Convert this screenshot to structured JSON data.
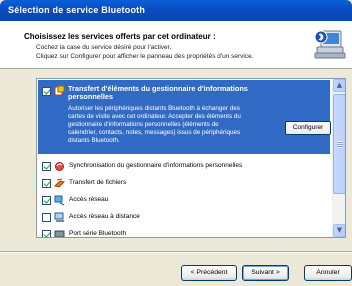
{
  "window": {
    "title": "Sélection de service Bluetooth"
  },
  "header": {
    "title": "Choisissez les services offerts par cet ordinateur :",
    "line1": "Cochez la case du service désiré pour l'activer.",
    "line2": "Cliquez sur Configurer pour afficher le panneau des propriétés d'un service."
  },
  "services": {
    "selected": {
      "title": "Transfert d'éléments du gestionnaire d'informations personnelles",
      "description": "Autoriser les périphériques distants Bluetooth à échanger des cartes de visite avec cet ordinateur. Accepter des éléments du gestionnaire d'informations personnelles (éléments de calendrier, contacts, notes, messages) issus de périphériques distants Bluetooth.",
      "configure_label": "Configurer",
      "checked": true,
      "icon": "pim-transfer-icon"
    },
    "items": [
      {
        "label": "Synchronisation du gestionnaire d'informations personnelles",
        "checked": true,
        "icon": "sync-icon"
      },
      {
        "label": "Transfert de fichiers",
        "checked": true,
        "icon": "file-transfer-icon"
      },
      {
        "label": "Accès réseau",
        "checked": true,
        "icon": "network-access-icon"
      },
      {
        "label": "Accès réseau à distance",
        "checked": false,
        "icon": "dialup-icon"
      },
      {
        "label": "Port série Bluetooth",
        "checked": true,
        "icon": "serial-port-icon"
      }
    ]
  },
  "buttons": {
    "prev": "< Précédent",
    "next": "Suivant >",
    "cancel": "Annuler"
  },
  "colors": {
    "titlebar": "#0a5fd8",
    "selection": "#316ac5",
    "dialog_bg": "#ece9d8"
  }
}
